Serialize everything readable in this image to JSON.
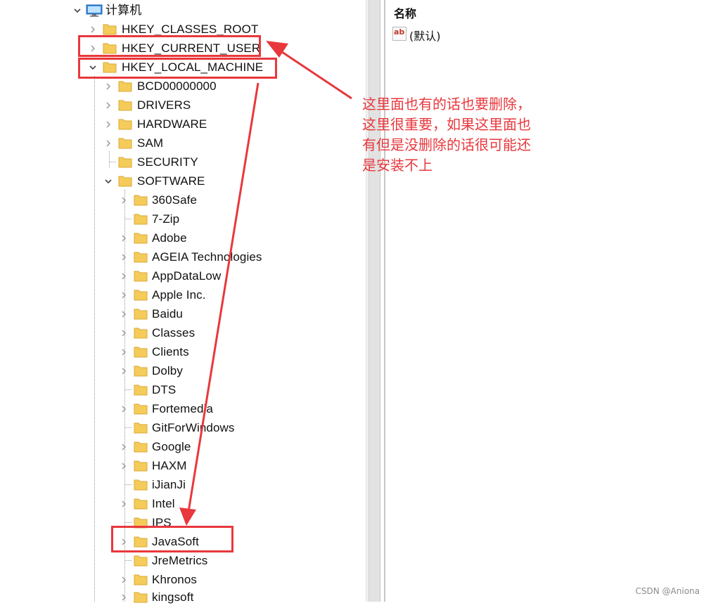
{
  "tree": {
    "root": {
      "label": "计算机",
      "icon": "computer-icon",
      "expanded": true
    },
    "hives": [
      {
        "label": "HKEY_CLASSES_ROOT",
        "expanded": false
      },
      {
        "label": "HKEY_CURRENT_USER",
        "expanded": false
      },
      {
        "label": "HKEY_LOCAL_MACHINE",
        "expanded": true
      }
    ],
    "local_machine_children": [
      {
        "label": "BCD00000000",
        "has_children": true
      },
      {
        "label": "DRIVERS",
        "has_children": true
      },
      {
        "label": "HARDWARE",
        "has_children": true
      },
      {
        "label": "SAM",
        "has_children": true
      },
      {
        "label": "SECURITY",
        "has_children": false
      },
      {
        "label": "SOFTWARE",
        "has_children": true,
        "expanded": true
      }
    ],
    "software_children": [
      {
        "label": "360Safe",
        "has_children": true
      },
      {
        "label": "7-Zip",
        "has_children": false
      },
      {
        "label": "Adobe",
        "has_children": true
      },
      {
        "label": "AGEIA Technologies",
        "has_children": true
      },
      {
        "label": "AppDataLow",
        "has_children": true
      },
      {
        "label": "Apple Inc.",
        "has_children": true
      },
      {
        "label": "Baidu",
        "has_children": true
      },
      {
        "label": "Classes",
        "has_children": true
      },
      {
        "label": "Clients",
        "has_children": true
      },
      {
        "label": "Dolby",
        "has_children": true
      },
      {
        "label": "DTS",
        "has_children": false
      },
      {
        "label": "Fortemedia",
        "has_children": true
      },
      {
        "label": "GitForWindows",
        "has_children": false
      },
      {
        "label": "Google",
        "has_children": true
      },
      {
        "label": "HAXM",
        "has_children": true
      },
      {
        "label": "iJianJi",
        "has_children": false
      },
      {
        "label": "Intel",
        "has_children": true
      },
      {
        "label": "IPS",
        "has_children": false
      },
      {
        "label": "JavaSoft",
        "has_children": true
      },
      {
        "label": "JreMetrics",
        "has_children": false
      },
      {
        "label": "Khronos",
        "has_children": true
      },
      {
        "label": "kingsoft",
        "has_children": true
      }
    ]
  },
  "values_pane": {
    "column_header": "名称",
    "rows": [
      {
        "icon": "ab",
        "name": "(默认)"
      }
    ]
  },
  "annotation": {
    "lines": [
      "这里面也有的话也要删除，",
      "这里很重要，如果这里面也",
      "有但是没删除的话很可能还",
      "是安装不上"
    ]
  },
  "watermark": "CSDN @Aniona",
  "colors": {
    "highlight": "#e8383d",
    "folder": "#f5cc5a",
    "folder_outline": "#d9a935"
  }
}
